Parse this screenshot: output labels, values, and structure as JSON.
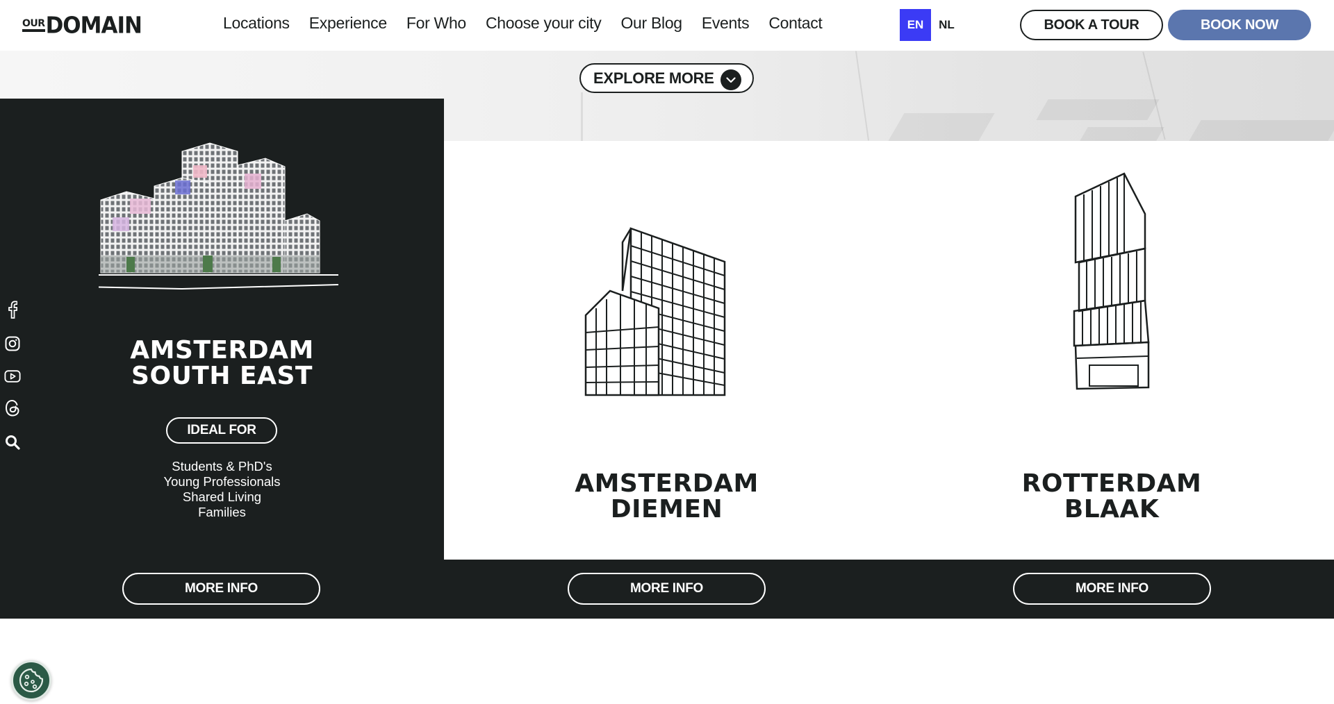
{
  "header": {
    "logo_small": "OUR",
    "logo_large": "DOMAIN",
    "nav": [
      "Locations",
      "Experience",
      "For Who",
      "Choose your city",
      "Our Blog",
      "Events",
      "Contact"
    ],
    "languages": {
      "active": "EN",
      "other": "NL"
    },
    "book_tour": "BOOK A TOUR",
    "book_now": "BOOK NOW"
  },
  "hero": {
    "explore_label": "EXPLORE MORE"
  },
  "cards": [
    {
      "title_line1": "AMSTERDAM",
      "title_line2": "SOUTH EAST",
      "ideal_label": "IDEAL FOR",
      "ideal_items": [
        "Students & PhD's",
        "Young Professionals",
        "Shared Living",
        "Families"
      ],
      "more_info": "MORE INFO",
      "icon": "photo-building-southeast"
    },
    {
      "title_line1": "AMSTERDAM",
      "title_line2": "DIEMEN",
      "more_info": "MORE INFO",
      "icon": "building-diemen-icon"
    },
    {
      "title_line1": "ROTTERDAM",
      "title_line2": "BLAAK",
      "more_info": "MORE INFO",
      "icon": "tower-blaak-icon"
    }
  ],
  "social": [
    "facebook-icon",
    "instagram-icon",
    "youtube-icon",
    "threads-icon",
    "search-icon"
  ],
  "colors": {
    "dark": "#1b1f1f",
    "accent_blue": "#3b3bf5",
    "book_now": "#5b76ae",
    "cookie_green": "#2b5a46"
  }
}
